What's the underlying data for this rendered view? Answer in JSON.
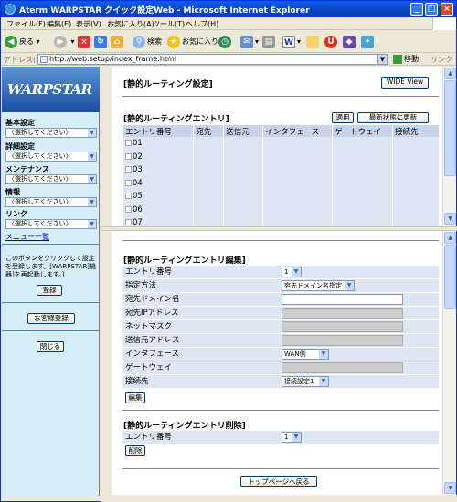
{
  "window": {
    "title": "Aterm WARPSTAR クイック設定Web - Microsoft Internet Explorer"
  },
  "menu": [
    "ファイル(F)",
    "編集(E)",
    "表示(V)",
    "お気に入り(A)",
    "ツール(T)",
    "ヘルプ(H)"
  ],
  "toolbar": {
    "back": "戻る",
    "search": "検索",
    "favorites": "お気に入り"
  },
  "address": {
    "label": "アドレス(D)",
    "url": "http://web.setup/index_frame.html",
    "go": "移動",
    "links": "リンク"
  },
  "sidebar": {
    "logo": "WARPSTAR",
    "sections": [
      {
        "heading": "基本設定",
        "select": "〈選択してください〉"
      },
      {
        "heading": "詳細設定",
        "select": "〈選択してください〉"
      },
      {
        "heading": "メンテナンス",
        "select": "〈選択してください〉"
      },
      {
        "heading": "情報",
        "select": "〈選択してください〉"
      },
      {
        "heading": "リンク",
        "select": "〈選択してください〉"
      }
    ],
    "menu_list": "メニュー一覧",
    "note": "このボタンをクリックして設定を登録します。[WARPSTAR]機器]を再起動します。]",
    "register": "登録",
    "customer_register": "お客様登録",
    "close": "閉じる"
  },
  "top_frame": {
    "title": "[静的ルーティング設定]",
    "wide_view": "WIDE View",
    "entry_title": "[静的ルーティングエントリ]",
    "apply": "適用",
    "refresh": "最新状態に更新",
    "columns": [
      "エントリ番号",
      "宛先",
      "送信元",
      "インタフェース",
      "ゲートウェイ",
      "接続先"
    ],
    "rows": [
      "01",
      "02",
      "03",
      "04",
      "05",
      "06",
      "07"
    ]
  },
  "bottom_frame": {
    "edit_title": "[静的ルーティングエントリ編集]",
    "fields": [
      {
        "label": "エントリ番号",
        "type": "select",
        "value": "1"
      },
      {
        "label": "指定方法",
        "type": "select",
        "value": "宛先ドメイン名指定"
      },
      {
        "label": "宛先ドメイン名",
        "type": "input"
      },
      {
        "label": "宛先IPアドレス",
        "type": "disabled"
      },
      {
        "label": "ネットマスク",
        "type": "disabled"
      },
      {
        "label": "送信元アドレス",
        "type": "disabled"
      },
      {
        "label": "インタフェース",
        "type": "select",
        "value": "WAN側"
      },
      {
        "label": "ゲートウェイ",
        "type": "disabled"
      },
      {
        "label": "接続先",
        "type": "select",
        "value": "接続設定1"
      }
    ],
    "edit_button": "編集",
    "delete_title": "[静的ルーティングエントリ削除]",
    "delete_field": {
      "label": "エントリ番号",
      "value": "1"
    },
    "delete_button": "削除",
    "top_page": "トップページへ戻る"
  }
}
